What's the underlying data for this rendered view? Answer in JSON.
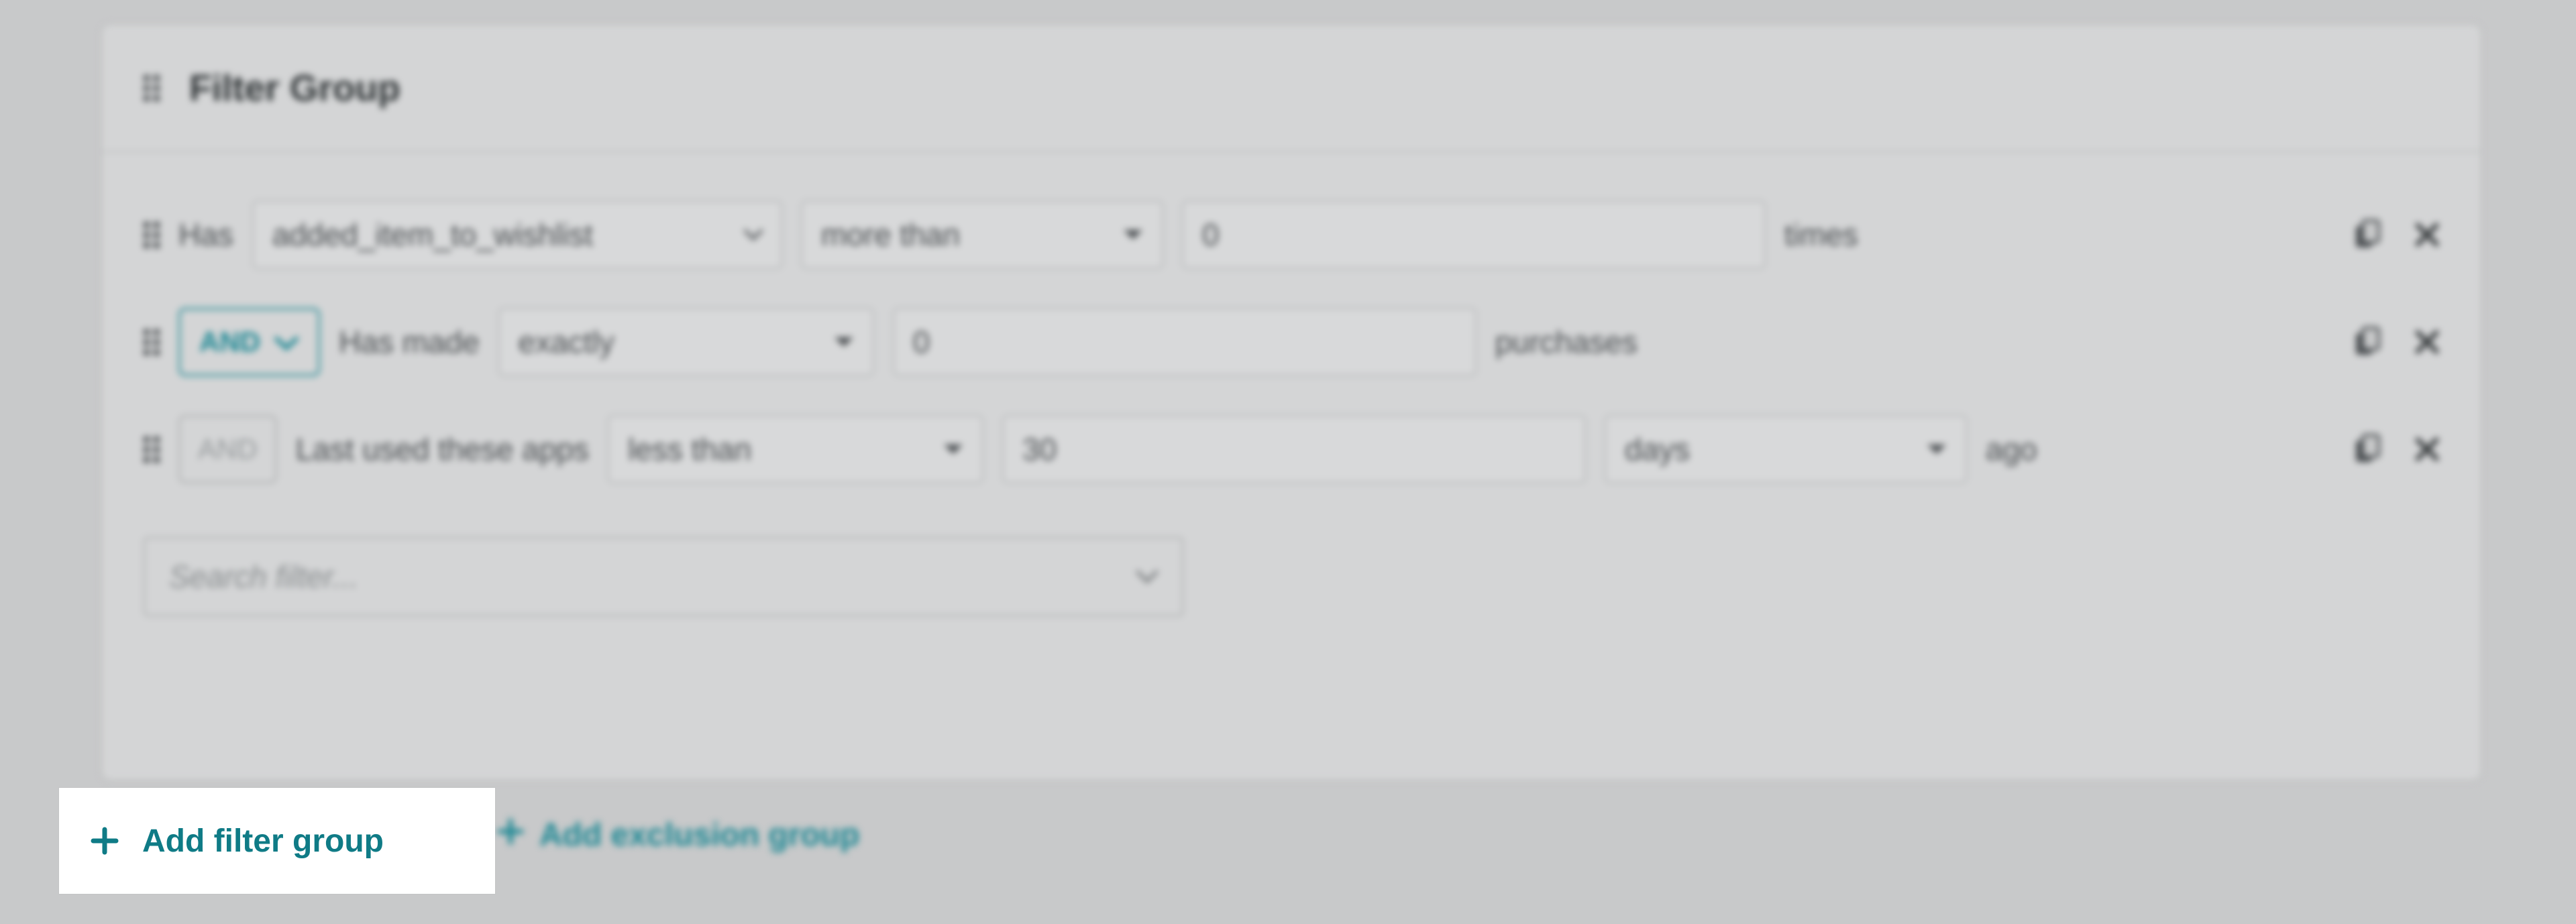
{
  "panel": {
    "title": "Filter Group"
  },
  "rules": [
    {
      "prefix": "Has",
      "event": "added_item_to_wishlist",
      "comparator": "more than",
      "value": "0",
      "suffix": "times"
    },
    {
      "logic": "AND",
      "prefix": "Has made",
      "comparator": "exactly",
      "value": "0",
      "suffix": "purchases"
    },
    {
      "logic": "AND",
      "prefix": "Last used these apps",
      "comparator": "less than",
      "value": "30",
      "unit": "days",
      "suffix": "ago"
    }
  ],
  "search": {
    "placeholder": "Search filter..."
  },
  "actions": {
    "add_filter_group": "Add filter group",
    "add_exclusion_group": "Add exclusion group"
  }
}
